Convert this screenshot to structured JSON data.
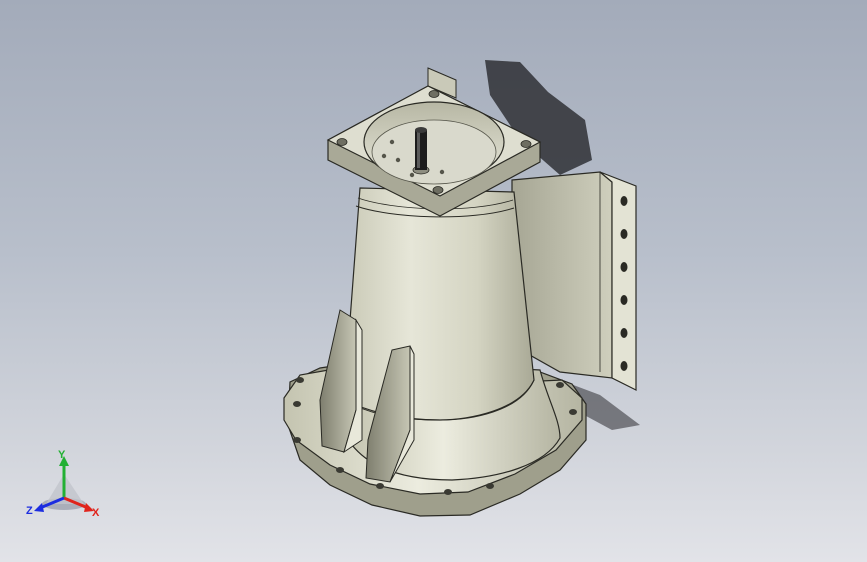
{
  "viewport": {
    "background_top": "#a3abba",
    "background_bottom": "#e2e3e8"
  },
  "model": {
    "body_color": "#d4d4c4",
    "edge_color": "#2a2a24",
    "shadow_color": "#2f3035",
    "shaft_color": "#1c1c1c",
    "bracket_hole_count": 6
  },
  "triad": {
    "x_label": "X",
    "y_label": "Y",
    "z_label": "Z",
    "x_color": "#e0241c",
    "y_color": "#22b033",
    "z_color": "#1c2de0"
  }
}
